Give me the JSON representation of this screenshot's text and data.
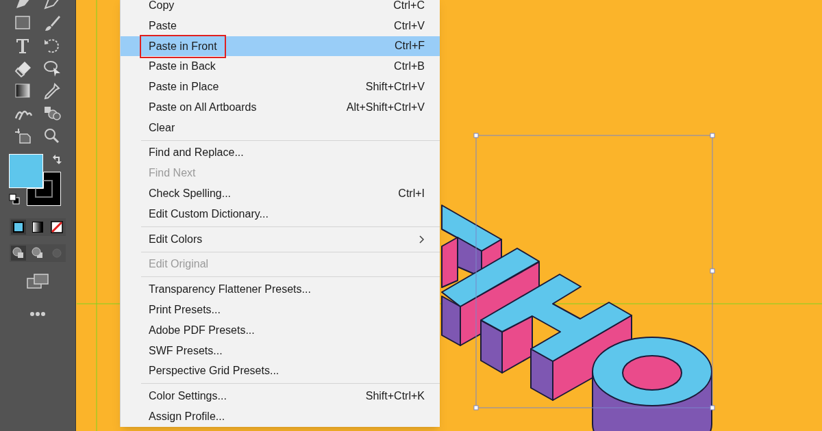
{
  "edit_menu": {
    "groups": [
      {
        "items": [
          {
            "label": "Copy",
            "shortcut": "Ctrl+C",
            "selected": false,
            "disabled": false,
            "annotated": false,
            "submenu": false
          },
          {
            "label": "Paste",
            "shortcut": "Ctrl+V",
            "selected": false,
            "disabled": false,
            "annotated": false,
            "submenu": false
          },
          {
            "label": "Paste in Front",
            "shortcut": "Ctrl+F",
            "selected": true,
            "disabled": false,
            "annotated": true,
            "submenu": false
          },
          {
            "label": "Paste in Back",
            "shortcut": "Ctrl+B",
            "selected": false,
            "disabled": false,
            "annotated": false,
            "submenu": false
          },
          {
            "label": "Paste in Place",
            "shortcut": "Shift+Ctrl+V",
            "selected": false,
            "disabled": false,
            "annotated": false,
            "submenu": false
          },
          {
            "label": "Paste on All Artboards",
            "shortcut": "Alt+Shift+Ctrl+V",
            "selected": false,
            "disabled": false,
            "annotated": false,
            "submenu": false
          },
          {
            "label": "Clear",
            "selected": false,
            "disabled": false,
            "annotated": false,
            "submenu": false
          }
        ]
      },
      {
        "items": [
          {
            "label": "Find and Replace...",
            "selected": false,
            "disabled": false,
            "annotated": false,
            "submenu": false
          },
          {
            "label": "Find Next",
            "selected": false,
            "disabled": true,
            "annotated": false,
            "submenu": false
          },
          {
            "label": "Check Spelling...",
            "shortcut": "Ctrl+I",
            "selected": false,
            "disabled": false,
            "annotated": false,
            "submenu": false
          },
          {
            "label": "Edit Custom Dictionary...",
            "selected": false,
            "disabled": false,
            "annotated": false,
            "submenu": false
          }
        ]
      },
      {
        "items": [
          {
            "label": "Edit Colors",
            "selected": false,
            "disabled": false,
            "annotated": false,
            "submenu": true
          }
        ]
      },
      {
        "items": [
          {
            "label": "Edit Original",
            "selected": false,
            "disabled": true,
            "annotated": false,
            "submenu": false
          }
        ]
      },
      {
        "items": [
          {
            "label": "Transparency Flattener Presets...",
            "selected": false,
            "disabled": false,
            "annotated": false,
            "submenu": false
          },
          {
            "label": "Print Presets...",
            "selected": false,
            "disabled": false,
            "annotated": false,
            "submenu": false
          },
          {
            "label": "Adobe PDF Presets...",
            "selected": false,
            "disabled": false,
            "annotated": false,
            "submenu": false
          },
          {
            "label": "SWF Presets...",
            "selected": false,
            "disabled": false,
            "annotated": false,
            "submenu": false
          },
          {
            "label": "Perspective Grid Presets...",
            "selected": false,
            "disabled": false,
            "annotated": false,
            "submenu": false
          }
        ]
      },
      {
        "items": [
          {
            "label": "Color Settings...",
            "shortcut": "Shift+Ctrl+K",
            "selected": false,
            "disabled": false,
            "annotated": false,
            "submenu": false
          },
          {
            "label": "Assign Profile...",
            "selected": false,
            "disabled": false,
            "annotated": false,
            "submenu": false
          }
        ]
      }
    ]
  }
}
